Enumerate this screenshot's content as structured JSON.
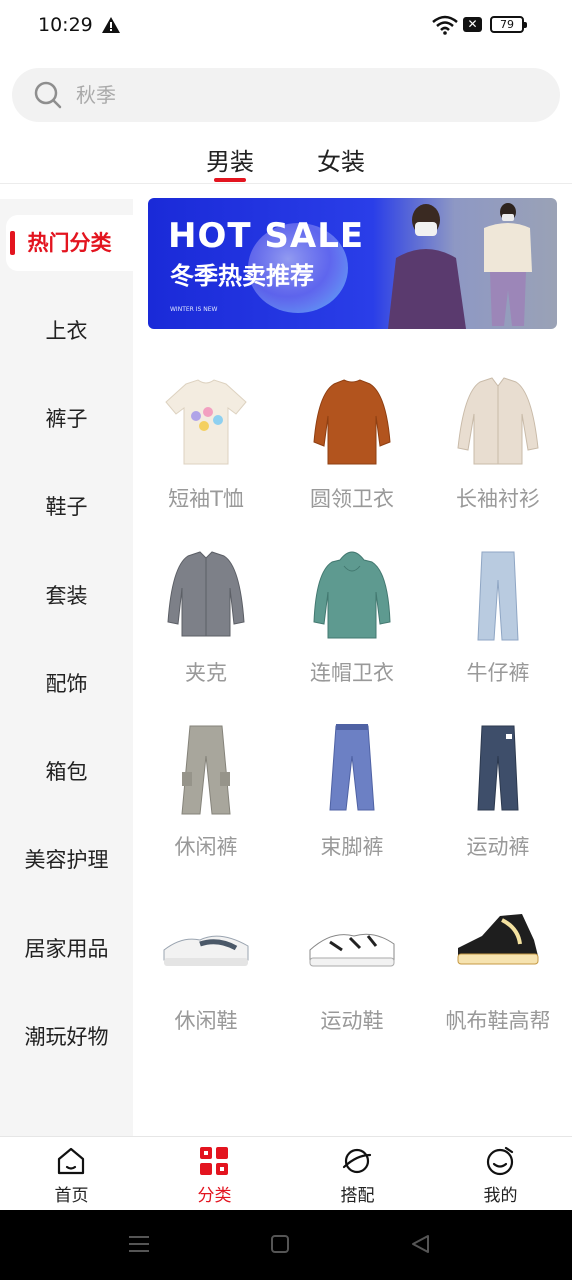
{
  "status": {
    "time": "10:29",
    "battery": "79"
  },
  "search": {
    "placeholder": "秋季"
  },
  "gender_tabs": [
    {
      "label": "男装",
      "active": true
    },
    {
      "label": "女装",
      "active": false
    }
  ],
  "sidebar": {
    "items": [
      {
        "label": "热门分类",
        "active": true
      },
      {
        "label": "上衣"
      },
      {
        "label": "裤子"
      },
      {
        "label": "鞋子"
      },
      {
        "label": "套装"
      },
      {
        "label": "配饰"
      },
      {
        "label": "箱包"
      },
      {
        "label": "美容护理"
      },
      {
        "label": "居家用品"
      },
      {
        "label": "潮玩好物"
      }
    ]
  },
  "banner": {
    "title": "HOT SALE",
    "subtitle": "冬季热卖推荐",
    "small": "WINTER IS NEW"
  },
  "categories": [
    {
      "label": "短袖T恤",
      "icon": "tshirt-image"
    },
    {
      "label": "圆领卫衣",
      "icon": "sweatshirt-image"
    },
    {
      "label": "长袖衬衫",
      "icon": "shirt-image"
    },
    {
      "label": "夹克",
      "icon": "jacket-image"
    },
    {
      "label": "连帽卫衣",
      "icon": "hoodie-image"
    },
    {
      "label": "牛仔裤",
      "icon": "jeans-image"
    },
    {
      "label": "休闲裤",
      "icon": "casual-pants-image"
    },
    {
      "label": "束脚裤",
      "icon": "jogger-pants-image"
    },
    {
      "label": "运动裤",
      "icon": "sport-pants-image"
    },
    {
      "label": "休闲鞋",
      "icon": "casual-shoe-image"
    },
    {
      "label": "运动鞋",
      "icon": "sneaker-image"
    },
    {
      "label": "帆布鞋高帮",
      "icon": "canvas-hightop-image"
    }
  ],
  "bottom_nav": [
    {
      "label": "首页",
      "icon": "home-icon"
    },
    {
      "label": "分类",
      "icon": "category-icon",
      "active": true
    },
    {
      "label": "搭配",
      "icon": "planet-icon"
    },
    {
      "label": "我的",
      "icon": "profile-face-icon"
    }
  ],
  "colors": {
    "accent": "#e3141f",
    "banner_bg": "#1f2fd6"
  }
}
